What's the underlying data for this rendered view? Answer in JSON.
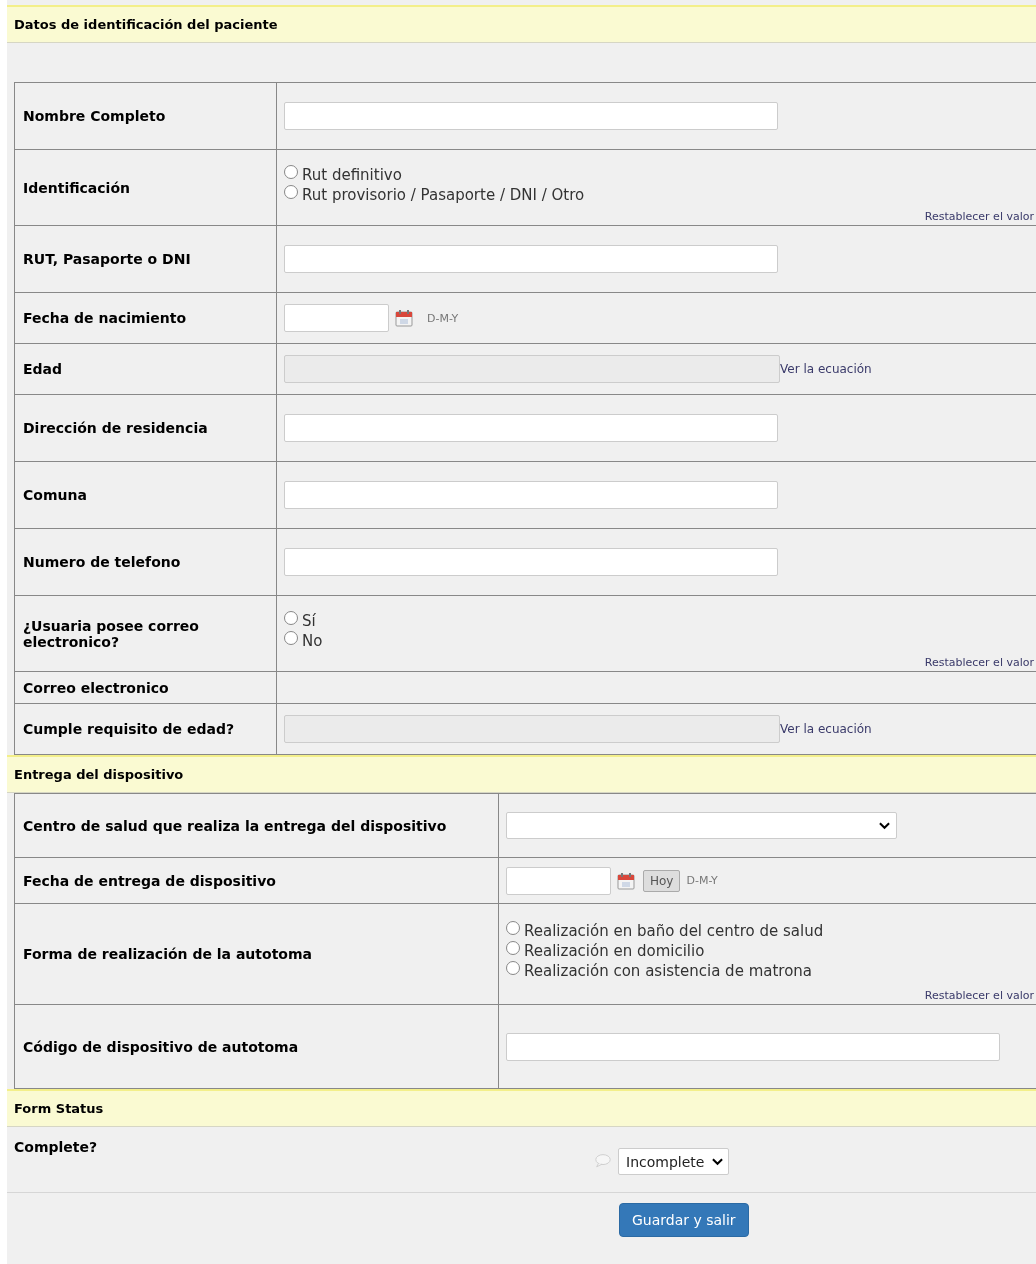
{
  "sections": [
    {
      "title": "Datos de identificación del paciente",
      "rows": [
        {
          "label": "Nombre Completo",
          "kind": "text"
        },
        {
          "label": "Identificación",
          "kind": "radio",
          "options": [
            {
              "label": "Rut definitivo",
              "selected": false
            },
            {
              "label": "Rut provisorio / Pasaporte / DNI / Otro",
              "selected": false
            }
          ],
          "reset": "Restablecer el valor"
        },
        {
          "label": "RUT, Pasaporte o DNI",
          "kind": "text"
        },
        {
          "label": "Fecha de nacimiento",
          "kind": "date",
          "format": "D-M-Y"
        },
        {
          "label": "Edad",
          "kind": "calc",
          "link": "Ver la ecuación"
        },
        {
          "label": "Dirección de residencia",
          "kind": "text"
        },
        {
          "label": "Comuna",
          "kind": "text"
        },
        {
          "label": "Numero de telefono",
          "kind": "text"
        },
        {
          "label": "¿Usuaria posee correo electronico?",
          "kind": "radio",
          "options": [
            {
              "label": "Sí",
              "selected": false
            },
            {
              "label": "No",
              "selected": false
            }
          ],
          "reset": "Restablecer el valor"
        },
        {
          "label": "Correo electronico",
          "kind": "empty"
        },
        {
          "label": "Cumple  requisito de edad?",
          "kind": "calc",
          "link": "Ver la ecuación"
        }
      ]
    },
    {
      "title": "Entrega del dispositivo",
      "rows": [
        {
          "label": "Centro de salud que realiza la entrega del dispositivo",
          "kind": "select"
        },
        {
          "label": "Fecha de entrega de dispositivo",
          "kind": "date",
          "today": "Hoy",
          "format": "D-M-Y"
        },
        {
          "label": "Forma de realización de la autotoma",
          "kind": "radio",
          "options": [
            {
              "label": "Realización en baño del centro de salud",
              "selected": false
            },
            {
              "label": "Realización en domicilio",
              "selected": false
            },
            {
              "label": "Realización con asistencia de matrona",
              "selected": false
            }
          ],
          "reset": "Restablecer el valor"
        },
        {
          "label": "Código de dispositivo de autotoma",
          "kind": "text"
        }
      ]
    }
  ],
  "form_status": {
    "title": "Form Status",
    "label": "Complete?",
    "value": "Incomplete"
  },
  "save_button": "Guardar y salir"
}
